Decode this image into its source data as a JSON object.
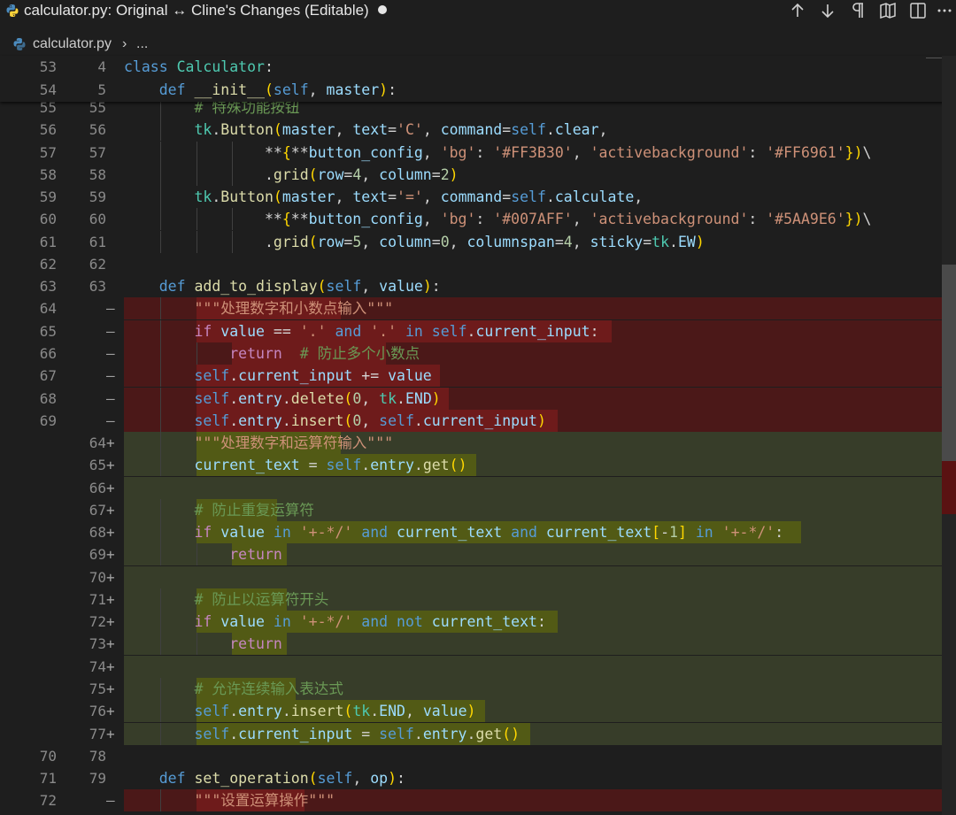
{
  "tab": {
    "title": "calculator.py: Original ↔ Cline's Changes (Editable)"
  },
  "breadcrumb": {
    "file": "calculator.py",
    "separator": "›",
    "more": "..."
  },
  "colors": {
    "deleted_line": "#4b1818",
    "deleted_text": "#6e1b1b",
    "inserted_line": "#373d29",
    "inserted_text": "#525a15",
    "editor_bg": "#1e1e1e"
  },
  "icons": [
    "python-file-icon",
    "arrow-up-icon",
    "arrow-down-icon",
    "pilcrow-icon",
    "book-icon",
    "split-editor-icon",
    "more-icon"
  ],
  "sticky": [
    {
      "old": "53",
      "new": "4",
      "text": "class Calculator:"
    },
    {
      "old": "54",
      "new": "5",
      "text": "    def __init__(self, master):"
    }
  ],
  "lines": [
    {
      "old": "55",
      "new": "55",
      "mark": "",
      "type": "ctx",
      "text": "        # 特殊功能按钮"
    },
    {
      "old": "56",
      "new": "56",
      "mark": "",
      "type": "ctx",
      "text": "        tk.Button(master, text='C', command=self.clear,"
    },
    {
      "old": "57",
      "new": "57",
      "mark": "",
      "type": "ctx",
      "text": "                **{**button_config, 'bg': '#FF3B30', 'activebackground': '#FF6961'})\\"
    },
    {
      "old": "58",
      "new": "58",
      "mark": "",
      "type": "ctx",
      "text": "                .grid(row=4, column=2)"
    },
    {
      "old": "59",
      "new": "59",
      "mark": "",
      "type": "ctx",
      "text": "        tk.Button(master, text='=', command=self.calculate,"
    },
    {
      "old": "60",
      "new": "60",
      "mark": "",
      "type": "ctx",
      "text": "                **{**button_config, 'bg': '#007AFF', 'activebackground': '#5AA9E6'})\\"
    },
    {
      "old": "61",
      "new": "61",
      "mark": "",
      "type": "ctx",
      "text": "                .grid(row=5, column=0, columnspan=4, sticky=tk.EW)"
    },
    {
      "old": "62",
      "new": "62",
      "mark": "",
      "type": "ctx",
      "text": ""
    },
    {
      "old": "63",
      "new": "63",
      "mark": "",
      "type": "ctx",
      "text": "    def add_to_display(self, value):"
    },
    {
      "old": "64",
      "new": "",
      "mark": "—",
      "type": "del",
      "text": "        \"\"\"处理数字和小数点输入\"\"\""
    },
    {
      "old": "65",
      "new": "",
      "mark": "—",
      "type": "del",
      "text": "        if value == '.' and '.' in self.current_input:"
    },
    {
      "old": "66",
      "new": "",
      "mark": "—",
      "type": "del",
      "text": "            return  # 防止多个小数点"
    },
    {
      "old": "67",
      "new": "",
      "mark": "—",
      "type": "del",
      "text": "        self.current_input += value"
    },
    {
      "old": "68",
      "new": "",
      "mark": "—",
      "type": "del",
      "text": "        self.entry.delete(0, tk.END)"
    },
    {
      "old": "69",
      "new": "",
      "mark": "—",
      "type": "del",
      "text": "        self.entry.insert(0, self.current_input)"
    },
    {
      "old": "",
      "new": "64",
      "mark": "+",
      "type": "add",
      "text": "        \"\"\"处理数字和运算符输入\"\"\""
    },
    {
      "old": "",
      "new": "65",
      "mark": "+",
      "type": "add",
      "text": "        current_text = self.entry.get()"
    },
    {
      "old": "",
      "new": "66",
      "mark": "+",
      "type": "add",
      "text": ""
    },
    {
      "old": "",
      "new": "67",
      "mark": "+",
      "type": "add",
      "text": "        # 防止重复运算符"
    },
    {
      "old": "",
      "new": "68",
      "mark": "+",
      "type": "add",
      "text": "        if value in '+-*/' and current_text and current_text[-1] in '+-*/':"
    },
    {
      "old": "",
      "new": "69",
      "mark": "+",
      "type": "add",
      "text": "            return"
    },
    {
      "old": "",
      "new": "70",
      "mark": "+",
      "type": "add",
      "text": ""
    },
    {
      "old": "",
      "new": "71",
      "mark": "+",
      "type": "add",
      "text": "        # 防止以运算符开头"
    },
    {
      "old": "",
      "new": "72",
      "mark": "+",
      "type": "add",
      "text": "        if value in '+-*/' and not current_text:"
    },
    {
      "old": "",
      "new": "73",
      "mark": "+",
      "type": "add",
      "text": "            return"
    },
    {
      "old": "",
      "new": "74",
      "mark": "+",
      "type": "add",
      "text": ""
    },
    {
      "old": "",
      "new": "75",
      "mark": "+",
      "type": "add",
      "text": "        # 允许连续输入表达式"
    },
    {
      "old": "",
      "new": "76",
      "mark": "+",
      "type": "add",
      "text": "        self.entry.insert(tk.END, value)"
    },
    {
      "old": "",
      "new": "77",
      "mark": "+",
      "type": "add",
      "text": "        self.current_input = self.entry.get()"
    },
    {
      "old": "70",
      "new": "78",
      "mark": "",
      "type": "ctx",
      "text": ""
    },
    {
      "old": "71",
      "new": "79",
      "mark": "",
      "type": "ctx",
      "text": "    def set_operation(self, op):"
    },
    {
      "old": "72",
      "new": "",
      "mark": "—",
      "type": "del",
      "text": "        \"\"\"设置运算操作\"\"\""
    }
  ]
}
